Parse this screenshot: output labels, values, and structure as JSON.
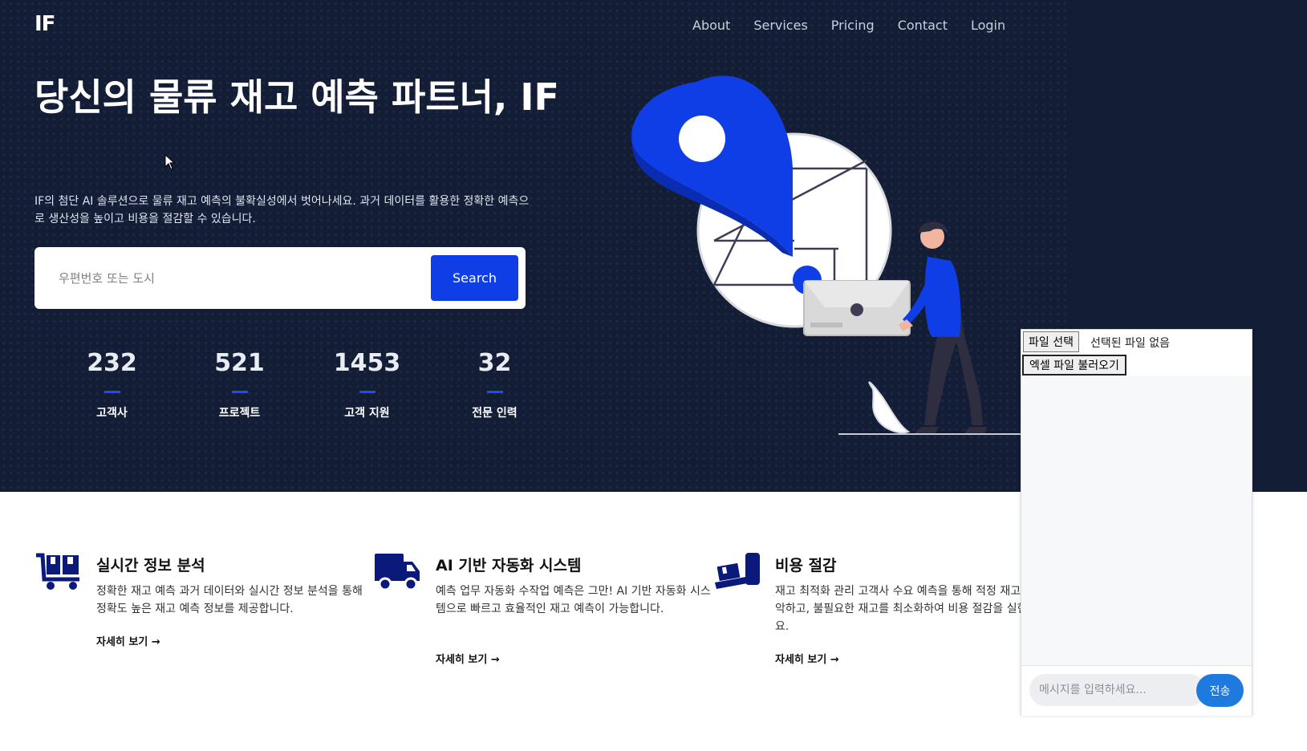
{
  "header": {
    "logo": "IF",
    "nav": [
      "About",
      "Services",
      "Pricing",
      "Contact",
      "Login"
    ]
  },
  "hero": {
    "headline": "당신의 물류 재고 예측 파트너, IF",
    "subtext": "IF의 첨단 AI 솔루션으로 물류 재고 예측의 불확실성에서 벗어나세요. 과거 데이터를 활용한 정확한 예측으로 생산성을 높이고 비용을 절감할 수 있습니다.",
    "search": {
      "placeholder": "우편번호 또는 도시",
      "value": "",
      "button_label": "Search"
    },
    "stats": [
      {
        "value": "232",
        "label": "고객사"
      },
      {
        "value": "521",
        "label": "프로젝트"
      },
      {
        "value": "1453",
        "label": "고객 지원"
      },
      {
        "value": "32",
        "label": "전문 인력"
      }
    ]
  },
  "features": [
    {
      "icon": "cart-icon",
      "title": "실시간 정보 분석",
      "description": "정확한 재고 예측 과거 데이터와 실시간 정보 분석을 통해 정확도 높은 재고 예측 정보를 제공합니다.",
      "link_label": "자세히 보기 →"
    },
    {
      "icon": "truck-icon",
      "title": "AI 기반 자동화 시스템",
      "description": "예측 업무 자동화 수작업 예측은 그만! AI 기반 자동화 시스템으로 빠르고 효율적인 재고 예측이 가능합니다.",
      "link_label": "자세히 보기 →"
    },
    {
      "icon": "hand-truck-icon",
      "title": "비용 절감",
      "description": "재고 최적화 관리 고객사 수요 예측을 통해 적정 재고를 파악하고, 불필요한 재고를 최소화하여 비용 절감을 실현하세요.",
      "link_label": "자세히 보기 →"
    }
  ],
  "chat": {
    "file_button": "파일 선택",
    "file_status": "선택된 파일 없음",
    "load_button": "엑셀 파일 불러오기",
    "message_placeholder": "메시지를 입력하세요...",
    "send_label": "전송"
  },
  "colors": {
    "hero_bg": "#131d36",
    "accent": "#0f3ee6",
    "send": "#1f7ae0",
    "icon": "#0b1a7a"
  }
}
